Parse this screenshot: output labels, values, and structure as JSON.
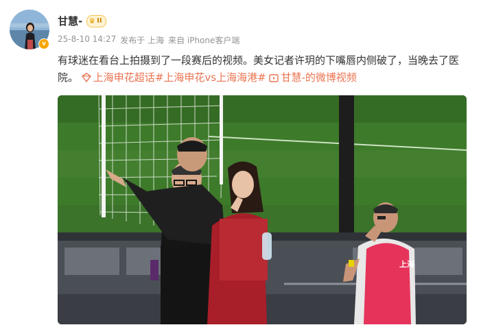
{
  "user": {
    "name": "甘慧-",
    "level_badge": "II",
    "verified_mark": "v"
  },
  "meta": {
    "timestamp": "25-8-10 14:27",
    "posted_from": "发布于 上海",
    "device": "来自 iPhone客户端"
  },
  "post": {
    "text": "有球迷在看台上拍摄到了一段赛后的视频。美女记者许玥的下嘴唇内侧破了，当晚去了医院。",
    "topics": [
      "上海申花超话",
      "#上海申花vs上海海港#"
    ],
    "video_link": "甘慧-的微博视频"
  },
  "media": {
    "vest_text": "上海"
  },
  "icons": {
    "level": "crown-icon",
    "topic": "super-topic-icon",
    "video": "video-icon",
    "verified": "verified-badge-icon"
  },
  "colors": {
    "link": "#eb7350",
    "meta": "#939393",
    "text": "#333333",
    "badge": "#f7a600"
  }
}
